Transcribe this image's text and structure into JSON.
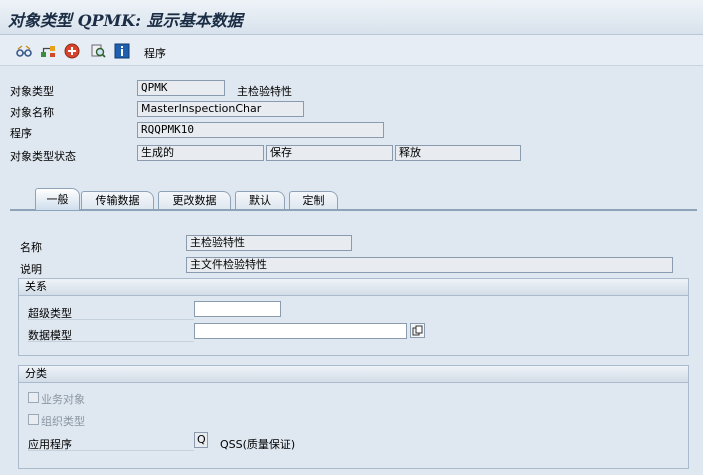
{
  "title": "对象类型 QPMK: 显示基本数据",
  "toolbar": {
    "icons": [
      "glasses-icon",
      "hierarchy-icon",
      "red-circle-icon",
      "find-icon",
      "info-icon"
    ],
    "program_label": "程序"
  },
  "header": {
    "object_type_label": "对象类型",
    "object_type_value": "QPMK",
    "object_type_desc": "主检验特性",
    "object_name_label": "对象名称",
    "object_name_value": "MasterInspectionChar",
    "program_label": "程序",
    "program_value": "RQQPMK10",
    "status_label": "对象类型状态",
    "status_values": [
      "生成的",
      "保存",
      "释放"
    ]
  },
  "tabs": [
    {
      "label": "一般",
      "active": true
    },
    {
      "label": "传输数据",
      "active": false
    },
    {
      "label": "更改数据",
      "active": false
    },
    {
      "label": "默认",
      "active": false
    },
    {
      "label": "定制",
      "active": false
    }
  ],
  "general": {
    "name_label": "名称",
    "name_value": "主检验特性",
    "desc_label": "说明",
    "desc_value": "主文件检验特性"
  },
  "relations": {
    "title": "关系",
    "supertype_label": "超级类型",
    "supertype_value": "",
    "datamodel_label": "数据模型",
    "datamodel_value": ""
  },
  "classification": {
    "title": "分类",
    "business_object_label": "业务对象",
    "org_type_label": "组织类型",
    "application_label": "应用程序",
    "application_value": "Q",
    "application_desc": "QSS(质量保证)"
  },
  "colors": {
    "background": "#dfe7f0",
    "title_text": "#1b2d44",
    "field_border": "#8a9bb0"
  }
}
